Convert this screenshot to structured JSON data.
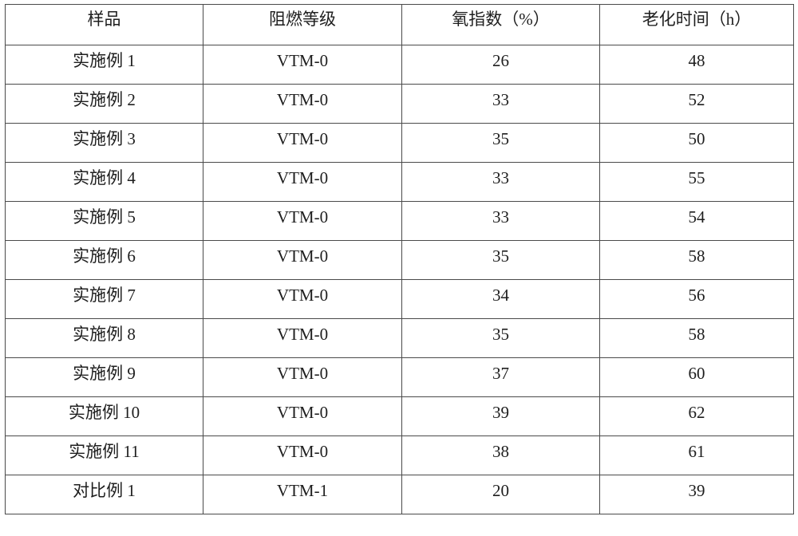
{
  "table": {
    "headers": [
      "样品",
      "阻燃等级",
      "氧指数（%）",
      "老化时间（h）"
    ],
    "rows": [
      [
        "实施例 1",
        "VTM-0",
        "26",
        "48"
      ],
      [
        "实施例 2",
        "VTM-0",
        "33",
        "52"
      ],
      [
        "实施例 3",
        "VTM-0",
        "35",
        "50"
      ],
      [
        "实施例 4",
        "VTM-0",
        "33",
        "55"
      ],
      [
        "实施例 5",
        "VTM-0",
        "33",
        "54"
      ],
      [
        "实施例 6",
        "VTM-0",
        "35",
        "58"
      ],
      [
        "实施例 7",
        "VTM-0",
        "34",
        "56"
      ],
      [
        "实施例 8",
        "VTM-0",
        "35",
        "58"
      ],
      [
        "实施例 9",
        "VTM-0",
        "37",
        "60"
      ],
      [
        "实施例 10",
        "VTM-0",
        "39",
        "62"
      ],
      [
        "实施例 11",
        "VTM-0",
        "38",
        "61"
      ],
      [
        "对比例 1",
        "VTM-1",
        "20",
        "39"
      ]
    ]
  }
}
